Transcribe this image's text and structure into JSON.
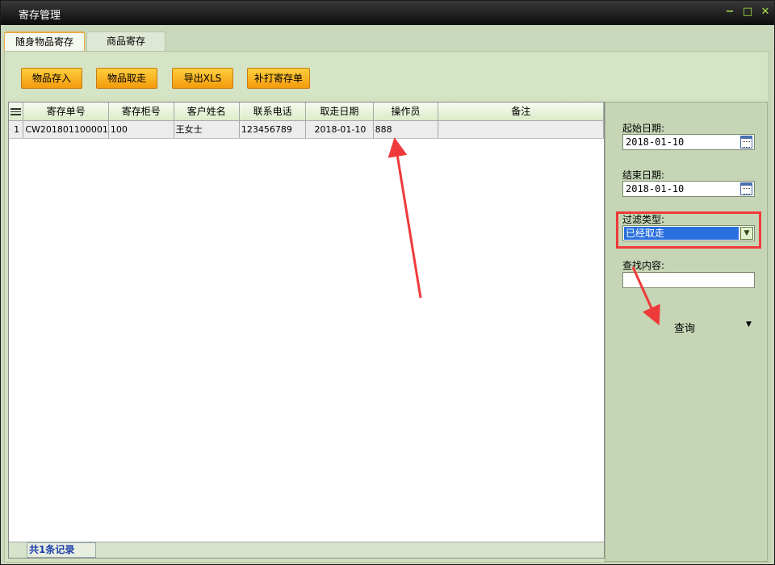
{
  "window": {
    "title": "寄存管理"
  },
  "tabs": [
    {
      "label": "随身物品寄存",
      "active": true
    },
    {
      "label": "商品寄存",
      "active": false
    }
  ],
  "toolbar": {
    "store_label": "物品存入",
    "retrieve_label": "物品取走",
    "export_label": "导出XLS",
    "reprint_label": "补打寄存单"
  },
  "grid": {
    "columns": [
      "寄存单号",
      "寄存柜号",
      "客户姓名",
      "联系电话",
      "取走日期",
      "操作员",
      "备注"
    ],
    "rows": [
      {
        "index": "1",
        "cells": [
          "CW201801100001",
          "100",
          "王女士",
          "123456789",
          "2018-01-10",
          "888",
          ""
        ]
      }
    ]
  },
  "status": {
    "record_count": "共1条记录"
  },
  "filter": {
    "start_label": "起始日期:",
    "start_value": "2018-01-10",
    "end_label": "结束日期:",
    "end_value": "2018-01-10",
    "type_label": "过滤类型:",
    "type_value": "已经取走",
    "search_label": "查找内容:",
    "search_value": "",
    "query_label": "查询"
  },
  "colors": {
    "accent": "#f39a0c",
    "highlight": "#ef3a3a",
    "selection": "#2a6fdf"
  }
}
